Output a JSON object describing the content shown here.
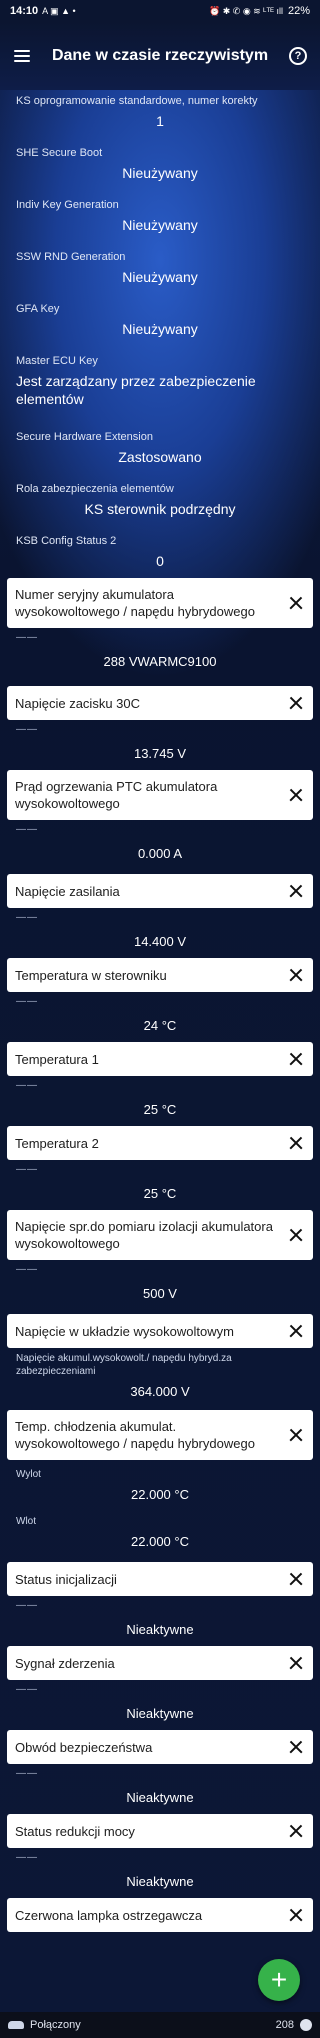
{
  "status_bar": {
    "time": "14:10",
    "left_icons": "A ▣ ▲ •",
    "right_icons": "⏰ ✱ ✆ ◉ ≋ ᴸᵀᴱ ıll",
    "battery": "22%"
  },
  "app_bar": {
    "title": "Dane w czasie rzeczywistym",
    "menu_icon": "hamburger-icon",
    "help_icon": "help-icon",
    "help_glyph": "?"
  },
  "plain_items": [
    {
      "label": "KS oprogramowanie standardowe, numer korekty",
      "value": "1"
    },
    {
      "label": "SHE Secure Boot",
      "value": "Nieużywany"
    },
    {
      "label": "Indiv Key Generation",
      "value": "Nieużywany"
    },
    {
      "label": "SSW RND Generation",
      "value": "Nieużywany"
    },
    {
      "label": "GFA Key",
      "value": "Nieużywany"
    },
    {
      "label": "Master ECU Key",
      "value": "Jest zarządzany przez zabezpieczenie elementów"
    },
    {
      "label": "Secure Hardware Extension",
      "value": "Zastosowano"
    },
    {
      "label": "Rola zabezpieczenia elementów",
      "value": "KS sterownik podrzędny"
    },
    {
      "label": "KSB Config Status 2",
      "value": "0"
    }
  ],
  "cards": [
    {
      "title": "Numer seryjny akumulatora wysokowoltowego / napędu hybrydowego",
      "dash": "——",
      "value": "288 VWARMC9100"
    },
    {
      "title": "Napięcie zacisku 30C",
      "dash": "——",
      "value": "13.745 V"
    },
    {
      "title": "Prąd ogrzewania PTC akumulatora wysokowoltowego",
      "dash": "——",
      "value": "0.000 A"
    },
    {
      "title": "Napięcie zasilania",
      "dash": "——",
      "value": "14.400 V"
    },
    {
      "title": "Temperatura w sterowniku",
      "dash": "——",
      "value": "24 °C"
    },
    {
      "title": "Temperatura 1",
      "dash": "——",
      "value": "25 °C"
    },
    {
      "title": "Temperatura 2",
      "dash": "——",
      "value": "25 °C"
    },
    {
      "title": "Napięcie spr.do pomiaru izolacji akumulatora wysokowoltowego",
      "dash": "——",
      "value": "500 V"
    },
    {
      "title": "Napięcie w układzie wysokowoltowym",
      "sublabel": "Napięcie akumul.wysokowolt./ napędu hybryd.za zabezpieczeniami",
      "value": "364.000 V"
    },
    {
      "title": "Temp. chłodzenia akumulat. wysokowoltowego / napędu hybrydowego",
      "rows": [
        {
          "label": "Wylot",
          "value": "22.000 °C"
        },
        {
          "label": "Wlot",
          "value": "22.000 °C"
        }
      ]
    },
    {
      "title": "Status inicjalizacji",
      "dash": "——",
      "value": "Nieaktywne"
    },
    {
      "title": "Sygnał zderzenia",
      "dash": "——",
      "value": "Nieaktywne"
    },
    {
      "title": "Obwód bezpieczeństwa",
      "dash": "——",
      "value": "Nieaktywne"
    },
    {
      "title": "Status redukcji mocy",
      "dash": "——",
      "value": "Nieaktywne"
    },
    {
      "title": "Czerwona lampka ostrzegawcza"
    }
  ],
  "fab": {
    "icon": "plus-icon",
    "glyph": "+"
  },
  "bottom_bar": {
    "status": "Połączony",
    "count": "208",
    "car_icon": "car-icon",
    "exit_icon": "exit-icon"
  },
  "colors": {
    "accent_green": "#36b24a",
    "background_blue": "#1a3e95"
  }
}
